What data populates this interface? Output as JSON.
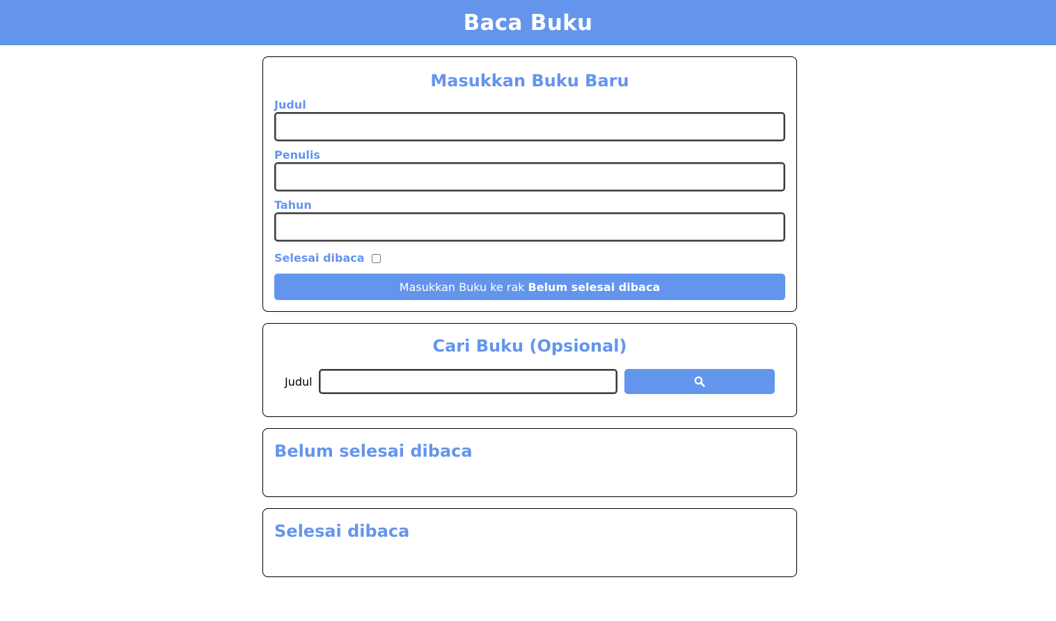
{
  "header": {
    "title": "Baca Buku"
  },
  "input_section": {
    "title": "Masukkan Buku Baru",
    "fields": [
      {
        "label": "Judul",
        "value": ""
      },
      {
        "label": "Penulis",
        "value": ""
      },
      {
        "label": "Tahun",
        "value": ""
      }
    ],
    "checkbox": {
      "label": "Selesai dibaca",
      "checked": false
    },
    "submit": {
      "prefix": "Masukkan Buku ke rak",
      "shelf": "Belum selesai dibaca"
    }
  },
  "search_section": {
    "title": "Cari Buku (Opsional)",
    "label": "Judul",
    "value": "",
    "button_icon": "search-icon"
  },
  "shelves": {
    "unread": {
      "title": "Belum selesai dibaca",
      "items": []
    },
    "read": {
      "title": "Selesai dibaca",
      "items": []
    }
  },
  "colors": {
    "accent": "#6495ED",
    "border": "#000000",
    "background": "#ffffff"
  }
}
